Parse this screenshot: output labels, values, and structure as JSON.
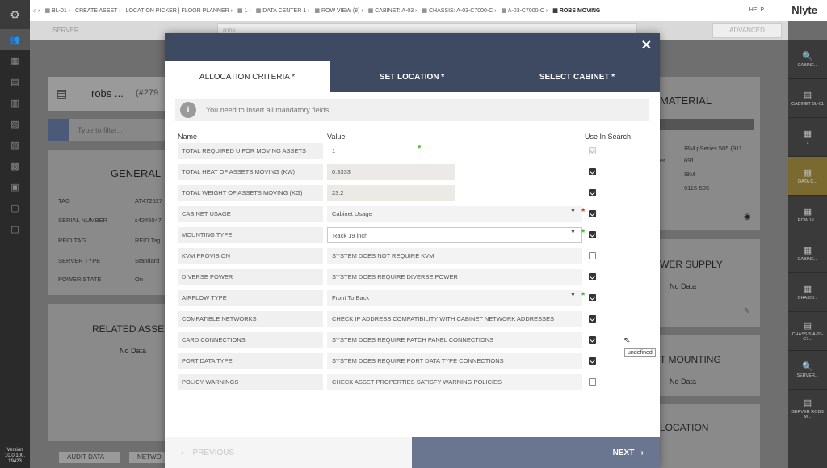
{
  "left_rail": {
    "version_lines": [
      "Version",
      "10.0.100.",
      "19423"
    ]
  },
  "topbar": {
    "breadcrumbs": [
      "BL-01",
      "CREATE ASSET",
      "LOCATION PICKER | FLOOR PLANNER",
      "1",
      "DATA CENTER 1",
      "ROW VIEW (8)",
      "CABINET: A-03",
      "CHASSIS: A-03-C7000-C",
      "A-03-C7000-C",
      "ROBS MOVING"
    ],
    "help": "HELP",
    "brand": "Nlyte"
  },
  "subbar": {
    "label": "SERVER",
    "search_value": "robs",
    "advanced": "ADVANCED"
  },
  "background": {
    "asset_title": "robs ...",
    "asset_id": "(#279",
    "filter_placeholder": "Type to filter...",
    "general_title": "GENERAL",
    "general_rows": [
      {
        "label": "TAG",
        "value": "AT472627"
      },
      {
        "label": "SERIAL NUMBER",
        "value": "s4245047"
      },
      {
        "label": "RFID TAG",
        "value": "RFID Tag"
      },
      {
        "label": "SERVER TYPE",
        "value": "Standard"
      },
      {
        "label": "POWER STATE",
        "value": "On"
      }
    ],
    "related_title": "RELATED ASSE",
    "related_nodata": "No Data",
    "bottom_tabs": [
      "AUDIT DATA",
      "NETWO"
    ],
    "material_title": "MATERIAL",
    "material_rows": [
      "IBM pSeries 505 (911...",
      "691",
      "IBM",
      "9115-505"
    ],
    "material_label_er": "er",
    "power_title": "WER SUPPLY",
    "power_nodata": "No Data",
    "mounting_title": "T MOUNTING",
    "mounting_nodata": "No Data",
    "location_title": "LOCATION"
  },
  "right_rail": [
    {
      "icon": "search-icon",
      "label": "CABINE..."
    },
    {
      "icon": "cabinet-icon",
      "label": "CABINET BL-01"
    },
    {
      "icon": "floor-icon",
      "label": "1"
    },
    {
      "icon": "datacenter-icon",
      "label": "DATA C..."
    },
    {
      "icon": "row-icon",
      "label": "ROW VI..."
    },
    {
      "icon": "cabinet-icon",
      "label": "CABINE..."
    },
    {
      "icon": "chassis-icon",
      "label": "CHASSI..."
    },
    {
      "icon": "chassis-icon",
      "label": "CHASSIS A-03-C7..."
    },
    {
      "icon": "search-icon",
      "label": "SERVER..."
    },
    {
      "icon": "server-icon",
      "label": "SERVER ROBS M..."
    }
  ],
  "modal": {
    "close": "✕",
    "tabs": [
      "ALLOCATION CRITERIA *",
      "SET LOCATION *",
      "SELECT CABINET *"
    ],
    "alert": "You need to insert all mandatory fields",
    "columns": {
      "name": "Name",
      "value": "Value",
      "use": "Use In Search"
    },
    "rows": [
      {
        "name": "TOTAL REQUIRED U FOR MOVING ASSETS",
        "value": "1",
        "style": "plain",
        "asterisk": "green",
        "check": "disabled"
      },
      {
        "name": "TOTAL HEAT OF ASSETS MOVING (KW)",
        "value": "0.3333",
        "style": "grey",
        "asterisk": "",
        "check": "checked"
      },
      {
        "name": "TOTAL WEIGHT OF ASSETS MOVING (KG)",
        "value": "23.2",
        "style": "grey",
        "asterisk": "",
        "check": "checked"
      },
      {
        "name": "CABINET USAGE",
        "value": "Cabinet Usage",
        "style": "select",
        "asterisk": "red",
        "check": "checked"
      },
      {
        "name": "MOUNTING TYPE",
        "value": "Rack 19 inch",
        "style": "select outlined",
        "asterisk": "green",
        "check": "checked"
      },
      {
        "name": "KVM PROVISION",
        "value": "SYSTEM DOES NOT REQUIRE KVM",
        "style": "wide",
        "asterisk": "",
        "check": "unchecked"
      },
      {
        "name": "DIVERSE POWER",
        "value": "SYSTEM DOES REQUIRE DIVERSE POWER",
        "style": "wide",
        "asterisk": "",
        "check": "checked"
      },
      {
        "name": "AIRFLOW TYPE",
        "value": "Front To Back",
        "style": "select",
        "asterisk": "green",
        "check": "checked"
      },
      {
        "name": "COMPATIBLE NETWORKS",
        "value": "CHECK IP ADDRESS COMPATIBILITY WITH CABINET NETWORK ADDRESSES",
        "style": "wide",
        "asterisk": "",
        "check": "checked"
      },
      {
        "name": "CARD CONNECTIONS",
        "value": "SYSTEM DOES REQUIRE PATCH PANEL CONNECTIONS",
        "style": "wide",
        "asterisk": "",
        "check": "checked"
      },
      {
        "name": "PORT DATA TYPE",
        "value": "SYSTEM DOES REQUIRE PORT DATA TYPE CONNECTIONS",
        "style": "wide",
        "asterisk": "",
        "check": "checked"
      },
      {
        "name": "POLICY WARNINGS",
        "value": "CHECK ASSET PROPERTIES SATISFY WARNING POLICIES",
        "style": "wide",
        "asterisk": "",
        "check": "unchecked"
      }
    ],
    "previous": "PREVIOUS",
    "next": "NEXT"
  },
  "tooltip": "undefined"
}
